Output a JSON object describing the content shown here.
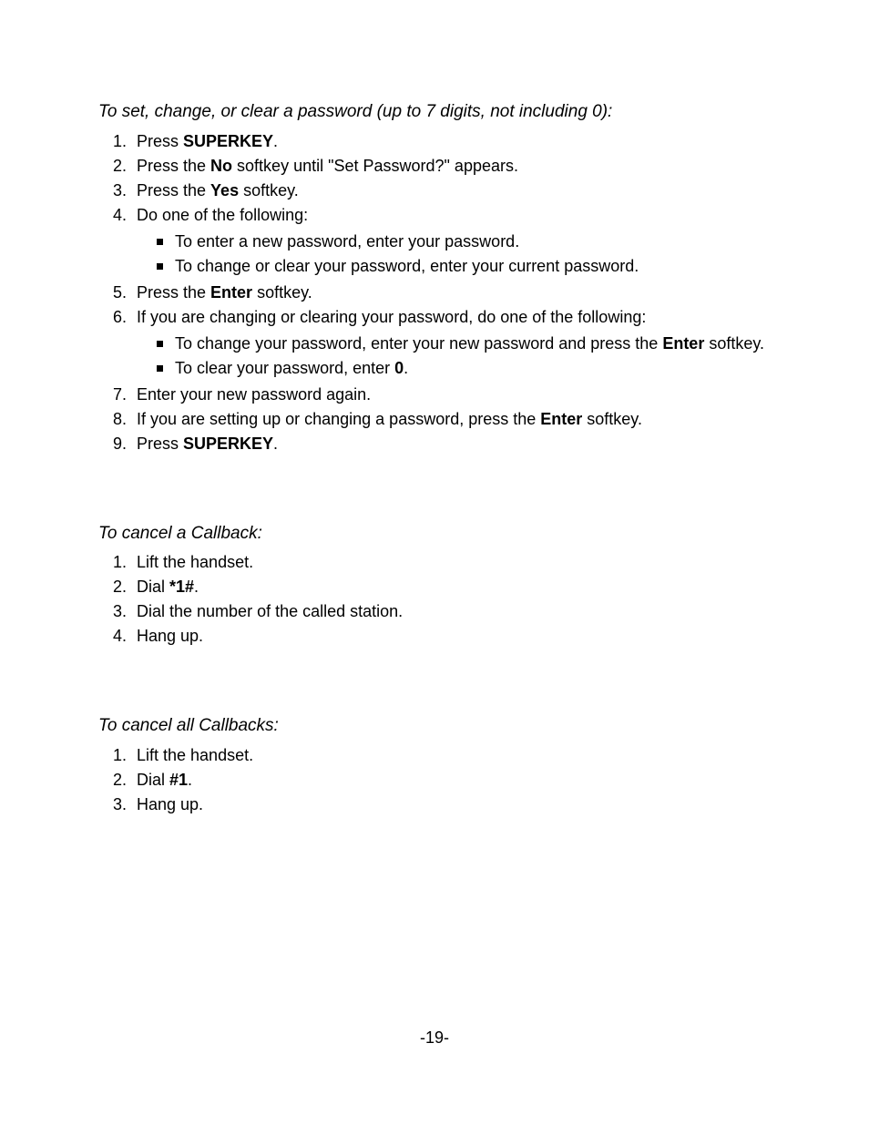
{
  "pageNumber": "-19-",
  "sections": [
    {
      "heading": "To set, change, or clear a password (up to 7 digits, not including 0):",
      "steps": [
        {
          "runs": [
            {
              "t": "Press "
            },
            {
              "t": "SUPERKEY",
              "b": true
            },
            {
              "t": "."
            }
          ]
        },
        {
          "runs": [
            {
              "t": "Press the "
            },
            {
              "t": "No",
              "b": true
            },
            {
              "t": " softkey until \"Set Password?\" appears."
            }
          ]
        },
        {
          "runs": [
            {
              "t": "Press the "
            },
            {
              "t": "Yes",
              "b": true
            },
            {
              "t": " softkey."
            }
          ]
        },
        {
          "runs": [
            {
              "t": "Do one of the following:"
            }
          ],
          "sub": [
            {
              "runs": [
                {
                  "t": "To enter a new password, enter your password."
                }
              ]
            },
            {
              "runs": [
                {
                  "t": "To change or clear your password, enter your current password."
                }
              ]
            }
          ]
        },
        {
          "runs": [
            {
              "t": "Press the "
            },
            {
              "t": "Enter",
              "b": true
            },
            {
              "t": " softkey."
            }
          ]
        },
        {
          "runs": [
            {
              "t": "If you are changing or clearing your password, do one of the following:"
            }
          ],
          "sub": [
            {
              "runs": [
                {
                  "t": "To change your password, enter your new password and press the "
                },
                {
                  "t": "Enter",
                  "b": true
                },
                {
                  "t": " softkey."
                }
              ]
            },
            {
              "runs": [
                {
                  "t": "To clear your password, enter "
                },
                {
                  "t": "0",
                  "b": true
                },
                {
                  "t": "."
                }
              ]
            }
          ]
        },
        {
          "runs": [
            {
              "t": "Enter your new password again."
            }
          ]
        },
        {
          "runs": [
            {
              "t": "If you are setting up or changing a password, press the "
            },
            {
              "t": "Enter",
              "b": true
            },
            {
              "t": " softkey."
            }
          ]
        },
        {
          "runs": [
            {
              "t": "Press "
            },
            {
              "t": "SUPERKEY",
              "b": true
            },
            {
              "t": "."
            }
          ]
        }
      ]
    },
    {
      "heading": "To cancel a Callback:",
      "steps": [
        {
          "runs": [
            {
              "t": "Lift the handset."
            }
          ]
        },
        {
          "runs": [
            {
              "t": "Dial "
            },
            {
              "t": "*1#",
              "b": true
            },
            {
              "t": "."
            }
          ]
        },
        {
          "runs": [
            {
              "t": "Dial the number of the called station."
            }
          ]
        },
        {
          "runs": [
            {
              "t": "Hang up."
            }
          ]
        }
      ]
    },
    {
      "heading": "To cancel all Callbacks:",
      "steps": [
        {
          "runs": [
            {
              "t": "Lift the handset."
            }
          ]
        },
        {
          "runs": [
            {
              "t": "Dial "
            },
            {
              "t": "#1",
              "b": true
            },
            {
              "t": "."
            }
          ]
        },
        {
          "runs": [
            {
              "t": "Hang up."
            }
          ]
        }
      ]
    }
  ]
}
